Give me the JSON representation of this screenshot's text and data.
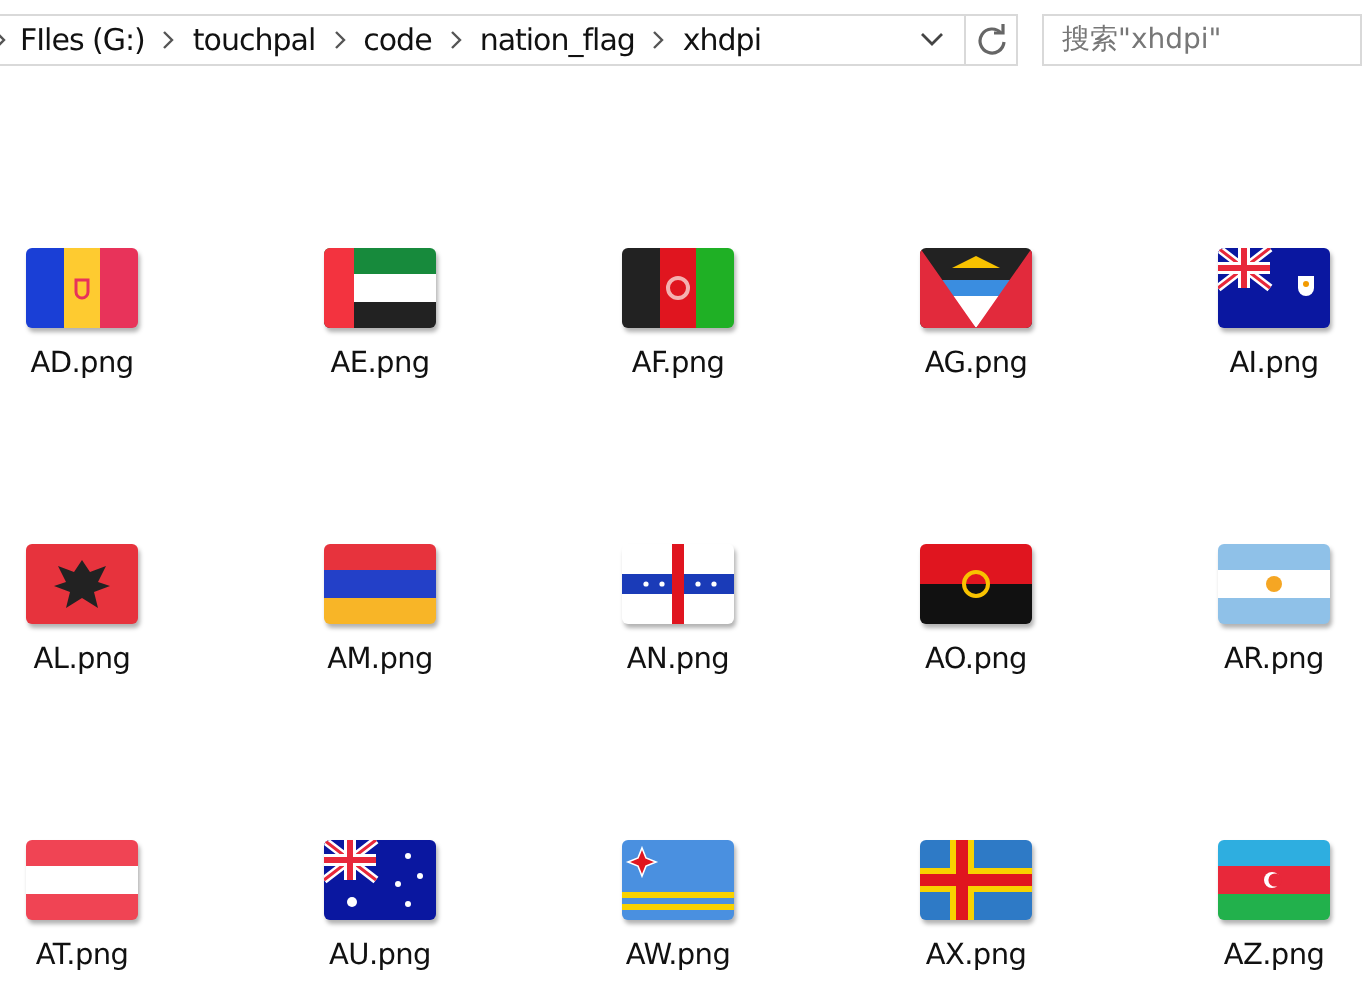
{
  "address_bar": {
    "crumbs": [
      "FIles (G:)",
      "touchpal",
      "code",
      "nation_flag",
      "xhdpi"
    ]
  },
  "search": {
    "placeholder": "搜索\"xhdpi\""
  },
  "files": [
    {
      "name": "AD.png"
    },
    {
      "name": "AE.png"
    },
    {
      "name": "AF.png"
    },
    {
      "name": "AG.png"
    },
    {
      "name": "AI.png"
    },
    {
      "name": "AL.png"
    },
    {
      "name": "AM.png"
    },
    {
      "name": "AN.png"
    },
    {
      "name": "AO.png"
    },
    {
      "name": "AR.png"
    },
    {
      "name": "AT.png"
    },
    {
      "name": "AU.png"
    },
    {
      "name": "AW.png"
    },
    {
      "name": "AX.png"
    },
    {
      "name": "AZ.png"
    }
  ]
}
